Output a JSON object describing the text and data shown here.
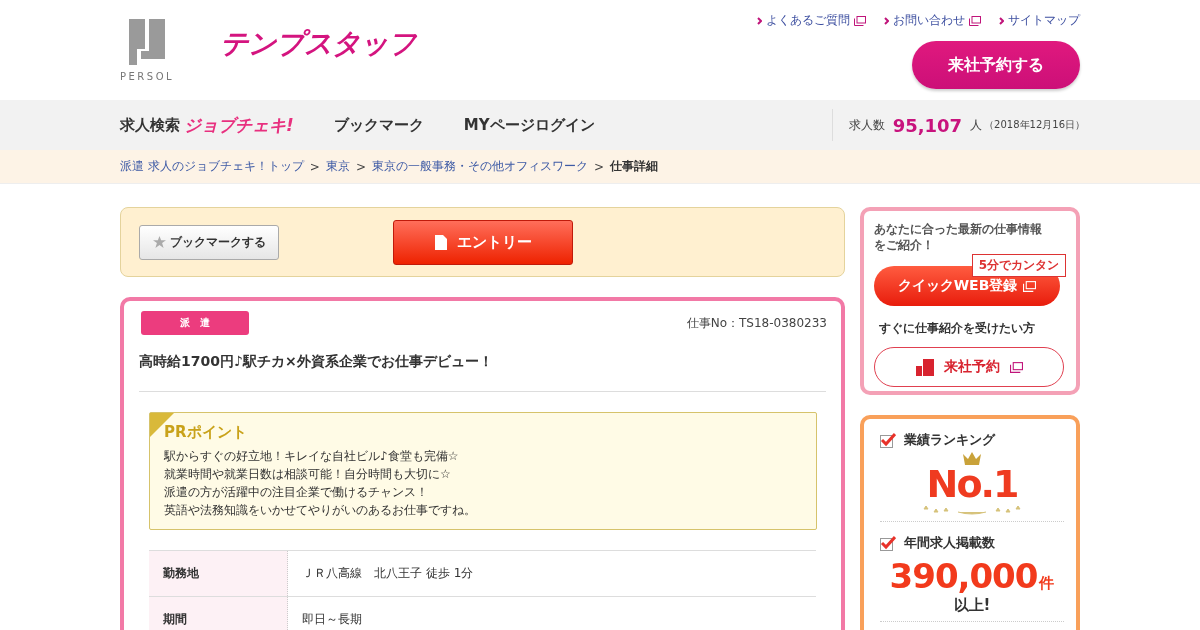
{
  "header": {
    "logo_text": "PERSOL",
    "brand": "テンプスタッフ",
    "top_links": [
      {
        "label": "よくあるご質問",
        "external": true
      },
      {
        "label": "お問い合わせ",
        "external": true
      },
      {
        "label": "サイトマップ",
        "external": false
      }
    ],
    "reserve_button": "来社予約する"
  },
  "nav": {
    "search_label": "求人検索",
    "search_badge": "ジョブチェキ!",
    "items": [
      "ブックマーク",
      "MYページログイン"
    ],
    "job_count": {
      "label": "求人数",
      "value": "95,107",
      "unit": "人",
      "date": "（2018年12月16日）"
    }
  },
  "breadcrumb": [
    {
      "label": "派遣 求人のジョブチェキ！トップ",
      "link": true
    },
    {
      "sep": ">",
      "label": "東京",
      "link": true
    },
    {
      "sep": ">",
      "label": "東京の一般事務・その他オフィスワーク",
      "link": true
    },
    {
      "sep": ">",
      "label": "仕事詳細",
      "link": false
    }
  ],
  "actions": {
    "bookmark_button": "ブックマークする",
    "entry_button": "エントリー"
  },
  "job": {
    "tag": "派　遣",
    "job_no": "仕事No：TS18-0380233",
    "title": "高時給1700円♪駅チカ×外資系企業でお仕事デビュー！",
    "pr": {
      "heading": "PRポイント",
      "lines": [
        "駅からすぐの好立地！キレイな自社ビル♪食堂も完備☆",
        "就業時間や就業日数は相談可能！自分時間も大切に☆",
        "派遣の方が活躍中の注目企業で働けるチャンス！",
        "英語や法務知識をいかせてやりがいのあるお仕事ですね。"
      ]
    },
    "details": [
      {
        "label": "勤務地",
        "values": [
          "ＪＲ八高線　北八王子 徒歩 1分"
        ]
      },
      {
        "label": "期間",
        "values": [
          "即日～長期"
        ]
      }
    ]
  },
  "sidebar": {
    "promo": {
      "intro": "あなたに合った最新の仕事情報をご紹介！",
      "balloon": "5分でカンタン",
      "web_button": "クイックWEB登録",
      "sub_text": "すぐに仕事紹介を受けたい方",
      "reserve_button": "来社予約"
    },
    "stats": [
      {
        "kind": "rank",
        "heading": "業績ランキング",
        "value": "No.1"
      },
      {
        "kind": "count",
        "heading": "年間求人掲載数",
        "value": "390,000",
        "unit": "件",
        "note": "以上!"
      }
    ]
  }
}
